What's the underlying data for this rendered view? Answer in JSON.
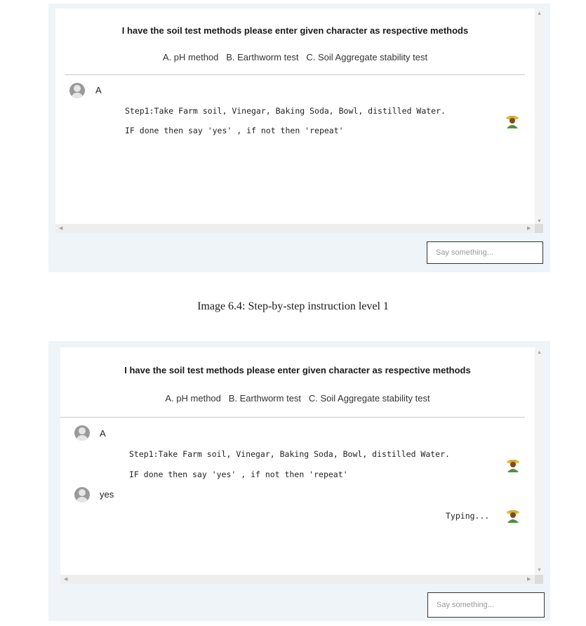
{
  "chat_header": {
    "title": "I have the soil test methods please enter given character as respective methods",
    "options": "A. pH method   B. Earthworm test   C. Soil Aggregate stability test"
  },
  "screen1": {
    "user_message": "A",
    "bot_lines": [
      "Step1:Take Farm soil, Vinegar, Baking Soda, Bowl, distilled Water.",
      "IF done then say 'yes' , if not then 'repeat'"
    ],
    "input_placeholder": "Say something..."
  },
  "caption": "Image 6.4: Step-by-step instruction level 1",
  "screen2": {
    "user_message_1": "A",
    "bot_lines": [
      "Step1:Take Farm soil, Vinegar, Baking Soda, Bowl, distilled Water.",
      "IF done then say 'yes' , if not then 'repeat'"
    ],
    "user_message_2": "yes",
    "typing_indicator": "Typing...",
    "input_placeholder": "Say something..."
  },
  "icons": {
    "user_avatar": "user-avatar-icon",
    "bot_avatar": "farmer-icon",
    "scroll_up": "chevron-up-icon",
    "scroll_down": "chevron-down-icon",
    "scroll_left": "chevron-left-icon",
    "scroll_right": "chevron-right-icon"
  },
  "colors": {
    "panel_background": "#eef4f7",
    "chat_background": "#ffffff",
    "divider": "#c9c9c9",
    "avatar_gray": "#9a9a9a",
    "farmer_hat": "#e2c23a",
    "farmer_body": "#4e8f3a"
  }
}
